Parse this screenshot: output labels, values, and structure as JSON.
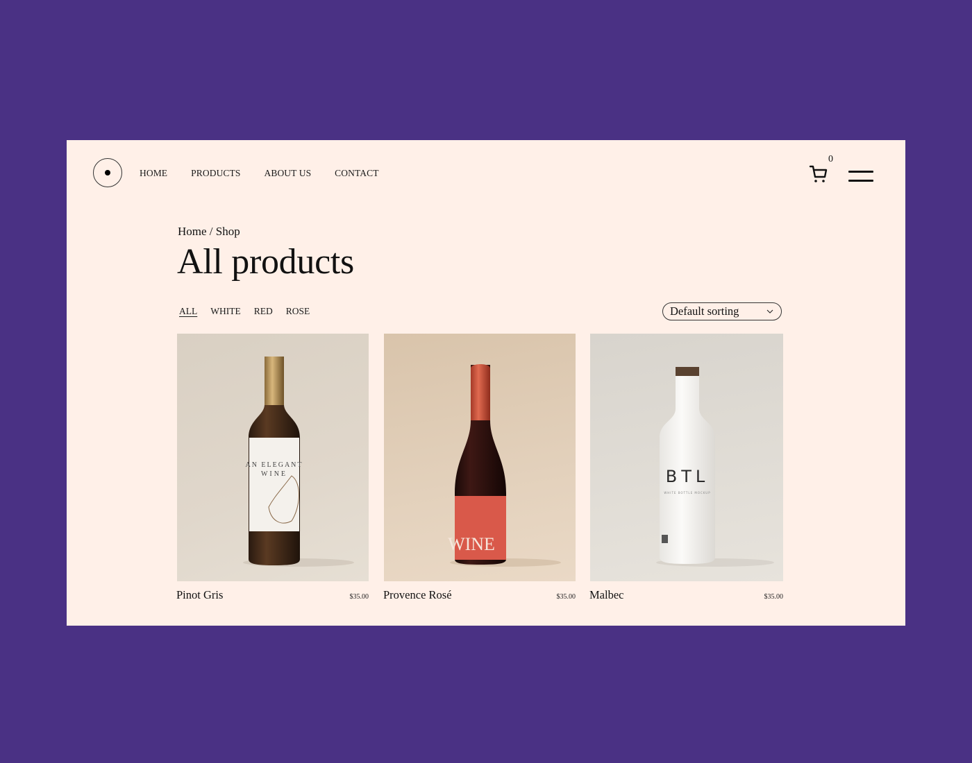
{
  "colors": {
    "background": "#4a3184",
    "page": "#fff0e8",
    "text": "#111111"
  },
  "header": {
    "logo_icon": "circle-dot-logo",
    "nav": [
      {
        "label": "HOME"
      },
      {
        "label": "PRODUCTS"
      },
      {
        "label": "ABOUT US"
      },
      {
        "label": "CONTACT"
      }
    ],
    "cart_icon": "shopping-cart-icon",
    "cart_count": "0",
    "menu_icon": "hamburger-menu-icon"
  },
  "breadcrumb": {
    "home": "Home",
    "separator": " / ",
    "current": "Shop"
  },
  "title": "All products",
  "filters": [
    {
      "label": "ALL",
      "active": true
    },
    {
      "label": "WHITE",
      "active": false
    },
    {
      "label": "RED",
      "active": false
    },
    {
      "label": "ROSE",
      "active": false
    }
  ],
  "sort": {
    "selected": "Default sorting",
    "icon": "chevron-down-icon"
  },
  "products": [
    {
      "name": "Pinot Gris",
      "price": "$35.00",
      "label_lines": [
        "AN ELEGANT",
        "WINE"
      ]
    },
    {
      "name": "Provence Rosé",
      "price": "$35.00",
      "label_lines": [
        "WINE"
      ]
    },
    {
      "name": "Malbec",
      "price": "$35.00",
      "label_lines": [
        "BTL",
        "WHITE BOTTLE MOCKUP"
      ]
    }
  ]
}
